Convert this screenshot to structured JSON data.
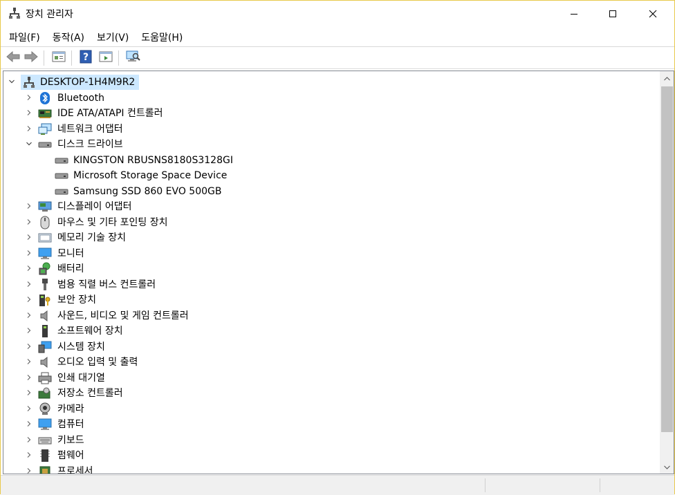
{
  "window": {
    "title": "장치 관리자"
  },
  "menu": [
    "파일(F)",
    "동작(A)",
    "보기(V)",
    "도움말(H)"
  ],
  "toolbar": [
    "back-icon",
    "forward-icon",
    "properties-icon",
    "help-icon",
    "action-icon",
    "scan-hardware-icon"
  ],
  "tree": {
    "root": "DESKTOP-1H4M9R2",
    "categories": [
      {
        "label": "Bluetooth",
        "icon": "bluetooth-icon",
        "expanded": false
      },
      {
        "label": "IDE ATA/ATAPI 컨트롤러",
        "icon": "ide-controller-icon",
        "expanded": false
      },
      {
        "label": "네트워크 어댑터",
        "icon": "network-adapter-icon",
        "expanded": false
      },
      {
        "label": "디스크 드라이브",
        "icon": "disk-drive-icon",
        "expanded": true,
        "children": [
          "KINGSTON RBUSNS8180S3128GI",
          "Microsoft Storage Space Device",
          "Samsung SSD 860 EVO 500GB"
        ]
      },
      {
        "label": "디스플레이 어댑터",
        "icon": "display-adapter-icon",
        "expanded": false
      },
      {
        "label": "마우스 및 기타 포인팅 장치",
        "icon": "mouse-icon",
        "expanded": false
      },
      {
        "label": "메모리 기술 장치",
        "icon": "memory-device-icon",
        "expanded": false
      },
      {
        "label": "모니터",
        "icon": "monitor-icon",
        "expanded": false
      },
      {
        "label": "배터리",
        "icon": "battery-icon",
        "expanded": false
      },
      {
        "label": "범용 직렬 버스 컨트롤러",
        "icon": "usb-icon",
        "expanded": false
      },
      {
        "label": "보안 장치",
        "icon": "security-device-icon",
        "expanded": false
      },
      {
        "label": "사운드, 비디오 및 게임 컨트롤러",
        "icon": "sound-icon",
        "expanded": false
      },
      {
        "label": "소프트웨어 장치",
        "icon": "software-device-icon",
        "expanded": false
      },
      {
        "label": "시스템 장치",
        "icon": "system-device-icon",
        "expanded": false
      },
      {
        "label": "오디오 입력 및 출력",
        "icon": "audio-io-icon",
        "expanded": false
      },
      {
        "label": "인쇄 대기열",
        "icon": "print-queue-icon",
        "expanded": false
      },
      {
        "label": "저장소 컨트롤러",
        "icon": "storage-controller-icon",
        "expanded": false
      },
      {
        "label": "카메라",
        "icon": "camera-icon",
        "expanded": false
      },
      {
        "label": "컴퓨터",
        "icon": "computer-icon",
        "expanded": false
      },
      {
        "label": "키보드",
        "icon": "keyboard-icon",
        "expanded": false
      },
      {
        "label": "펌웨어",
        "icon": "firmware-icon",
        "expanded": false
      },
      {
        "label": "프로세서",
        "icon": "processor-icon",
        "expanded": false
      }
    ]
  },
  "colors": {
    "selection": "#cce8ff",
    "accent": "#0078d7",
    "border": "#e8c94a"
  }
}
